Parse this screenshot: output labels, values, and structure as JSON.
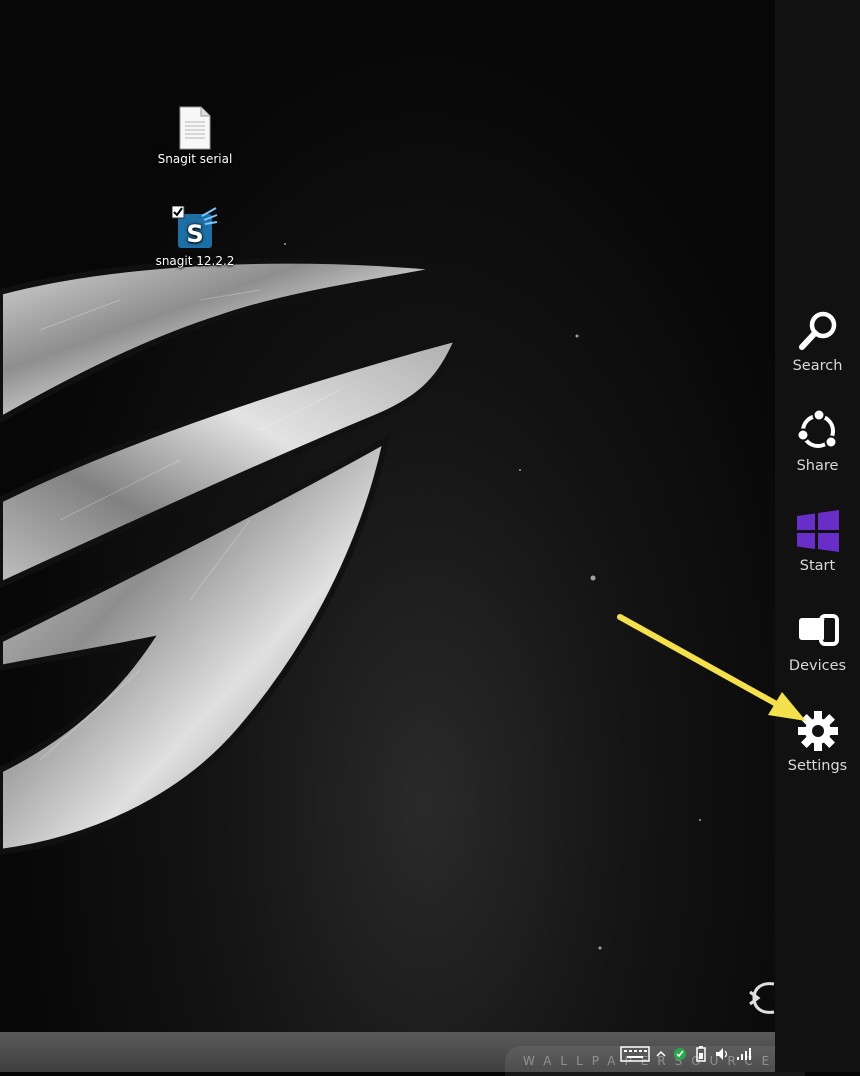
{
  "desktop": {
    "icons": [
      {
        "label": "Snagit serial",
        "icon": "text-document-icon"
      },
      {
        "label": "snagit 12.2.2",
        "icon": "snagit-app-icon"
      }
    ]
  },
  "charms": [
    {
      "label": "Search",
      "icon": "search-icon"
    },
    {
      "label": "Share",
      "icon": "share-icon"
    },
    {
      "label": "Start",
      "icon": "windows-start-icon"
    },
    {
      "label": "Devices",
      "icon": "devices-icon"
    },
    {
      "label": "Settings",
      "icon": "gear-icon"
    }
  ],
  "taskbar": {
    "watermark": "WALLPAPERSOURCE",
    "tray_icons": [
      "keyboard-icon",
      "show-hidden-icons-chevron",
      "sync-status-icon",
      "battery-icon",
      "volume-icon",
      "network-signal-icon"
    ]
  },
  "colors": {
    "charms_background": "#111111",
    "start_accent": "#6a2ec8",
    "annotation_arrow": "#f4e04d"
  }
}
